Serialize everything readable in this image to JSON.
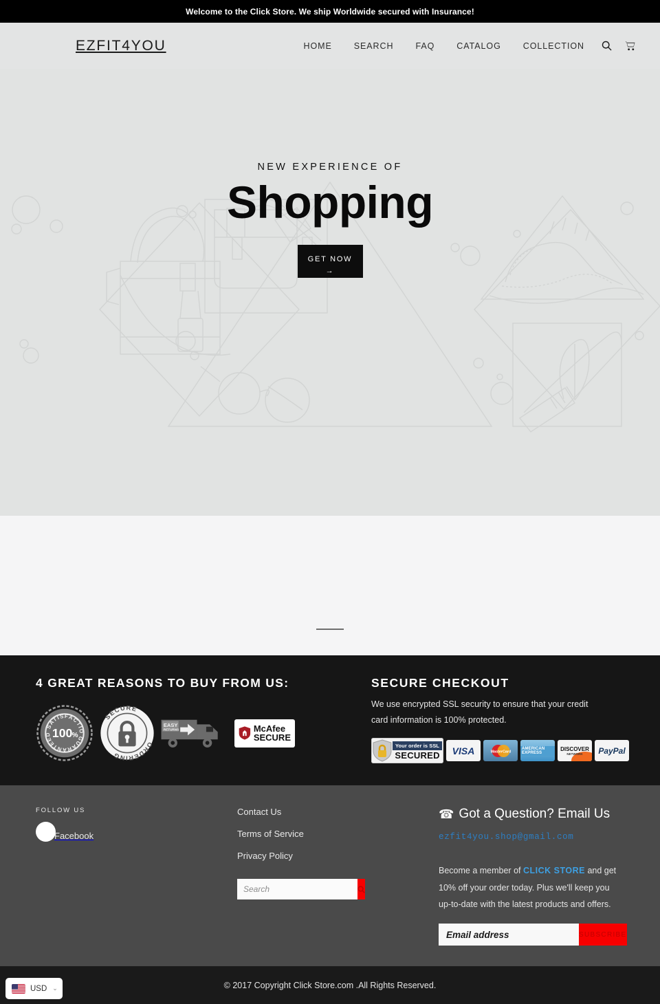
{
  "announcement": {
    "text": "Welcome to the Click Store. We ship Worldwide secured with Insurance!"
  },
  "header": {
    "logo": "EZFIT4YOU",
    "nav": [
      {
        "label": "HOME"
      },
      {
        "label": "SEARCH"
      },
      {
        "label": "FAQ"
      },
      {
        "label": "CATALOG"
      },
      {
        "label": "COLLECTION"
      }
    ],
    "icons": [
      {
        "name": "search-icon"
      },
      {
        "name": "cart-icon"
      }
    ]
  },
  "hero": {
    "supertitle": "NEW EXPERIENCE OF",
    "title": "Shopping",
    "button_label": "GET NOW",
    "button_arrow": "→",
    "background_color": "#e1e3e2"
  },
  "trust": {
    "heading": "4 GREAT REASONS TO BUY FROM US:",
    "badges": [
      {
        "name": "satisfaction-guaranteed-badge",
        "line1": "SATISFACTION",
        "value": "100",
        "unit": "%",
        "line2": "GUARANTEED"
      },
      {
        "name": "secure-ordering-badge",
        "line1": "SECURE",
        "line2": "ORDERING"
      },
      {
        "name": "easy-returns-truck-badge",
        "line1": "EASY",
        "line2": "RETURNS"
      },
      {
        "name": "mcafee-secure-badge",
        "line1": "McAfee",
        "line2": "SECURE"
      }
    ]
  },
  "secure_checkout": {
    "heading": "SECURE CHECKOUT",
    "description": "We use encrypted SSL security to ensure that your credit card information is 100% protected.",
    "ssl_badge": {
      "top": "Your order is SSL",
      "bottom": "SECURED"
    },
    "cards": [
      {
        "name": "visa-card-icon",
        "label": "VISA"
      },
      {
        "name": "mastercard-card-icon",
        "label": "MasterCard"
      },
      {
        "name": "amex-card-icon",
        "label": "AMERICAN EXPRESS"
      },
      {
        "name": "discover-card-icon",
        "label": "DISCOVER",
        "sub": "NETWORK"
      },
      {
        "name": "paypal-card-icon",
        "label": "PayPal"
      }
    ]
  },
  "footer": {
    "follow_label": "FOLLOW US",
    "social": [
      {
        "name": "facebook-icon",
        "label": "Facebook"
      }
    ],
    "links": [
      {
        "label": "Contact Us"
      },
      {
        "label": "Terms of Service"
      },
      {
        "label": "Privacy Policy"
      }
    ],
    "search": {
      "placeholder": "Search",
      "value": "",
      "button_icon": "search-icon"
    },
    "contact": {
      "heading": "Got a Question? Email Us",
      "phone_icon": "☎",
      "email": "ezfit4you.shop@gmail.com"
    },
    "newsletter": {
      "text_before": "Become a member of ",
      "brand": "CLICK STORE",
      "text_after": " and get 10% off your order today. Plus we'll keep you up-to-date with the latest products and offers.",
      "placeholder": "Email address",
      "value": "",
      "button_label": "SUBSCRIBE"
    }
  },
  "bottom": {
    "copyright": "© 2017 Copyright Click Store.com .All Rights Reserved.",
    "currency": {
      "code": "USD",
      "flag": "us-flag-icon",
      "chevron": "⌄"
    }
  },
  "colors": {
    "accent_red": "#f70000",
    "link_blue": "#3da0e3",
    "dark": "#161616",
    "footer_gray": "#4a4a4a"
  }
}
